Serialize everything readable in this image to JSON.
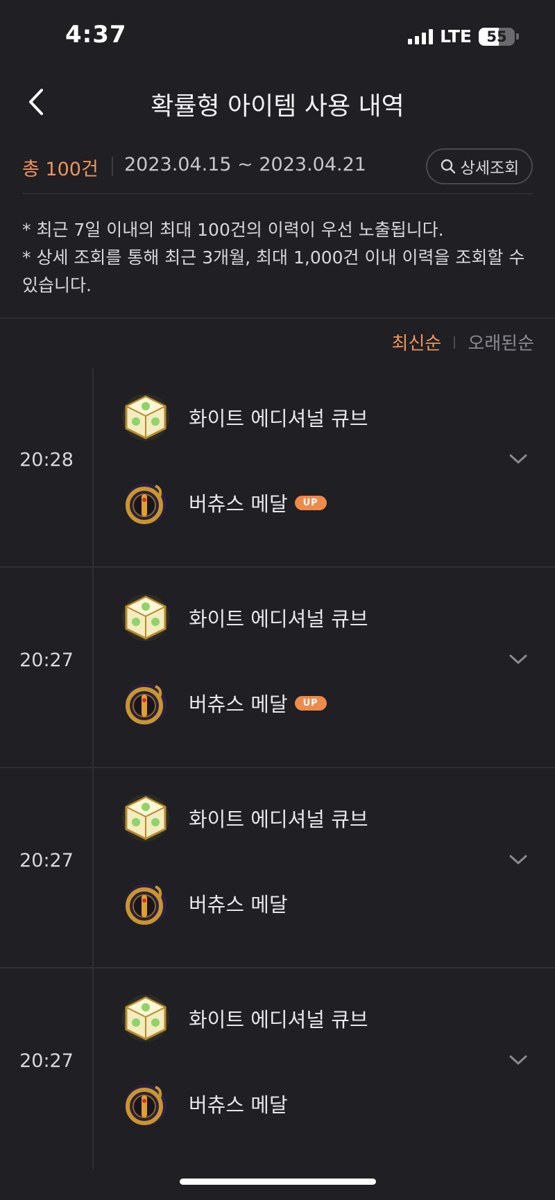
{
  "status": {
    "time": "4:37",
    "network": "LTE",
    "battery_text": "55",
    "battery_level": 0.55
  },
  "header": {
    "title": "확률형 아이템 사용 내역",
    "back_icon": "chevron-left-icon"
  },
  "summary": {
    "total": "총 100건",
    "range": "2023.04.15 ~ 2023.04.21",
    "detail_button": "상세조회",
    "accent_color": "#f0955a"
  },
  "notes": {
    "line1": "* 최근 7일 이내의 최대 100건의 이력이 우선 노출됩니다.",
    "line2": "* 상세 조회를 통해 최근 3개월, 최대 1,000건 이내 이력을 조회할 수 있습니다."
  },
  "sort": {
    "newest": "최신순",
    "oldest": "오래된순"
  },
  "records": [
    {
      "time": "20:28",
      "item_a": "화이트 에디셔널 큐브",
      "item_b": "버츄스 메달",
      "item_b_badge": "UP"
    },
    {
      "time": "20:27",
      "item_a": "화이트 에디셔널 큐브",
      "item_b": "버츄스 메달",
      "item_b_badge": "UP"
    },
    {
      "time": "20:27",
      "item_a": "화이트 에디셔널 큐브",
      "item_b": "버츄스 메달",
      "item_b_badge": ""
    },
    {
      "time": "20:27",
      "item_a": "화이트 에디셔널 큐브",
      "item_b": "버츄스 메달",
      "item_b_badge": ""
    }
  ]
}
